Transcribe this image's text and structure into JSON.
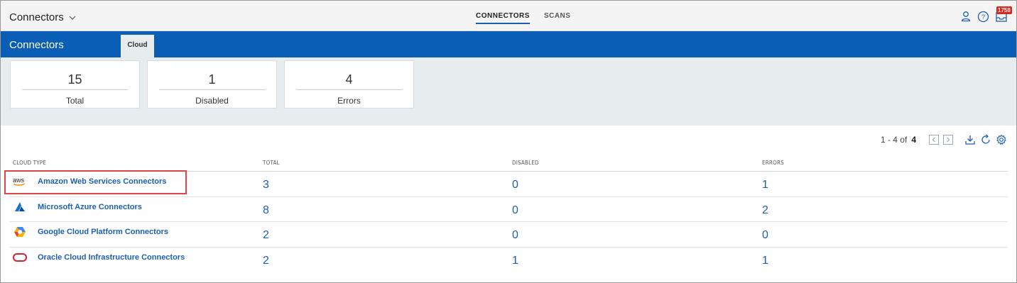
{
  "app": {
    "title": "Connectors"
  },
  "nav_tabs": [
    {
      "label": "CONNECTORS",
      "active": true
    },
    {
      "label": "SCANS",
      "active": false
    }
  ],
  "notifications": {
    "count": "1758"
  },
  "header": {
    "title": "Connectors",
    "tab": "Cloud"
  },
  "stats": [
    {
      "value": "15",
      "label": "Total"
    },
    {
      "value": "1",
      "label": "Disabled"
    },
    {
      "value": "4",
      "label": "Errors"
    }
  ],
  "pager": {
    "range": "1 - 4 of",
    "total": "4"
  },
  "table": {
    "columns": [
      "CLOUD TYPE",
      "TOTAL",
      "DISABLED",
      "ERRORS"
    ],
    "rows": [
      {
        "name": "Amazon Web Services Connectors",
        "logo": "aws-icon",
        "total": "3",
        "disabled": "0",
        "errors": "1"
      },
      {
        "name": "Microsoft Azure Connectors",
        "logo": "azure-icon",
        "total": "8",
        "disabled": "0",
        "errors": "2"
      },
      {
        "name": "Google Cloud Platform Connectors",
        "logo": "gcp-icon",
        "total": "2",
        "disabled": "0",
        "errors": "0"
      },
      {
        "name": "Oracle Cloud Infrastructure Connectors",
        "logo": "oracle-icon",
        "total": "2",
        "disabled": "1",
        "errors": "1"
      }
    ]
  },
  "colors": {
    "brand_blue": "#0a5eb6",
    "link": "#1b5fb4",
    "badge": "#d9251d",
    "highlight": "#e04545"
  }
}
